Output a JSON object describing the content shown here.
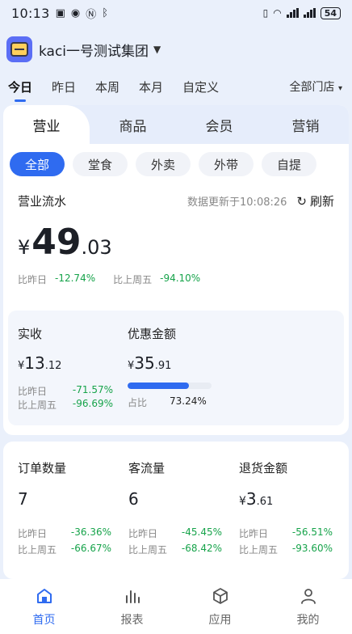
{
  "status_bar": {
    "time": "10:13",
    "battery": "54"
  },
  "header": {
    "org_name": "kaci一号测试集团"
  },
  "period_tabs": [
    "今日",
    "昨日",
    "本周",
    "本月",
    "自定义"
  ],
  "store_filter": "全部门店",
  "biz_tabs": [
    "营业",
    "商品",
    "会员",
    "营销"
  ],
  "chips": [
    "全部",
    "堂食",
    "外卖",
    "外带",
    "自提"
  ],
  "flow": {
    "title": "营业流水",
    "updated": "数据更新于10:08:26",
    "refresh_label": "刷新",
    "currency": "¥",
    "amount_int": "49",
    "amount_dec": ".03",
    "cmp_day_label": "比昨日",
    "cmp_day_val": "-12.74%",
    "cmp_week_label": "比上周五",
    "cmp_week_val": "-94.10%"
  },
  "received": {
    "title": "实收",
    "currency": "¥",
    "amount_int": "13",
    "amount_dec": ".12",
    "cmp_day_label": "比昨日",
    "cmp_day_val": "-71.57%",
    "cmp_week_label": "比上周五",
    "cmp_week_val": "-96.69%"
  },
  "discount": {
    "title": "优惠金额",
    "currency": "¥",
    "amount_int": "35",
    "amount_dec": ".91",
    "progress": 0.7324,
    "ratio_label": "占比",
    "ratio_val": "73.24%"
  },
  "stats": [
    {
      "title": "订单数量",
      "currency": "",
      "int": "7",
      "dec": "",
      "cmp_day_label": "比昨日",
      "cmp_day_val": "-36.36%",
      "cmp_week_label": "比上周五",
      "cmp_week_val": "-66.67%"
    },
    {
      "title": "客流量",
      "currency": "",
      "int": "6",
      "dec": "",
      "cmp_day_label": "比昨日",
      "cmp_day_val": "-45.45%",
      "cmp_week_label": "比上周五",
      "cmp_week_val": "-68.42%"
    },
    {
      "title": "退货金额",
      "currency": "¥",
      "int": "3",
      "dec": ".61",
      "cmp_day_label": "比昨日",
      "cmp_day_val": "-56.51%",
      "cmp_week_label": "比上周五",
      "cmp_week_val": "-93.60%"
    }
  ],
  "tabbar": [
    {
      "label": "首页",
      "icon": "home-icon"
    },
    {
      "label": "报表",
      "icon": "chart-icon"
    },
    {
      "label": "应用",
      "icon": "cube-icon"
    },
    {
      "label": "我的",
      "icon": "user-icon"
    }
  ],
  "colors": {
    "accent": "#2f6bf0",
    "negative": "#16a34a"
  }
}
